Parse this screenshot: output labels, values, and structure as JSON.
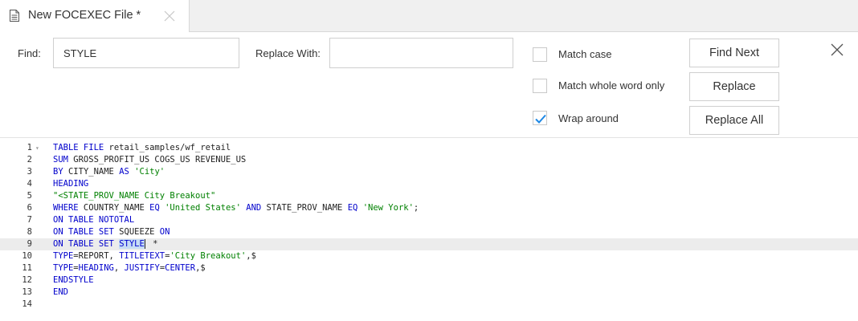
{
  "tab": {
    "title": "New FOCEXEC File *"
  },
  "find_bar": {
    "find_label": "Find:",
    "find_value": "STYLE",
    "replace_label": "Replace With:",
    "replace_value": "",
    "options": [
      {
        "label": "Match case",
        "checked": false
      },
      {
        "label": "Match whole word only",
        "checked": false
      },
      {
        "label": "Wrap around",
        "checked": true
      }
    ],
    "buttons": {
      "find_next": "Find Next",
      "replace": "Replace",
      "replace_all": "Replace All"
    }
  },
  "colors": {
    "accent": "#1e88e5",
    "keyword": "#0000cc",
    "string": "#008000",
    "selection": "#c6dcf5",
    "active_line": "#ececec"
  },
  "editor": {
    "active_line": 9,
    "lines": [
      {
        "n": "1",
        "fold": "▾",
        "parts": [
          {
            "t": "TABLE FILE",
            "c": "kw"
          },
          {
            "t": " retail_samples/wf_retail",
            "c": "tx"
          }
        ]
      },
      {
        "n": "2",
        "parts": [
          {
            "t": "SUM",
            "c": "kw"
          },
          {
            "t": " GROSS_PROFIT_US COGS_US REVENUE_US",
            "c": "tx"
          }
        ]
      },
      {
        "n": "3",
        "parts": [
          {
            "t": "BY",
            "c": "kw"
          },
          {
            "t": " CITY_NAME ",
            "c": "tx"
          },
          {
            "t": "AS",
            "c": "kw"
          },
          {
            "t": " ",
            "c": "tx"
          },
          {
            "t": "'City'",
            "c": "str"
          }
        ]
      },
      {
        "n": "4",
        "parts": [
          {
            "t": "HEADING",
            "c": "kw"
          }
        ]
      },
      {
        "n": "5",
        "parts": [
          {
            "t": "\"<STATE_PROV_NAME City Breakout\"",
            "c": "str"
          }
        ]
      },
      {
        "n": "6",
        "parts": [
          {
            "t": "WHERE",
            "c": "kw"
          },
          {
            "t": " COUNTRY_NAME ",
            "c": "tx"
          },
          {
            "t": "EQ",
            "c": "kw"
          },
          {
            "t": " ",
            "c": "tx"
          },
          {
            "t": "'United States'",
            "c": "str"
          },
          {
            "t": " ",
            "c": "tx"
          },
          {
            "t": "AND",
            "c": "kw"
          },
          {
            "t": " STATE_PROV_NAME ",
            "c": "tx"
          },
          {
            "t": "EQ",
            "c": "kw"
          },
          {
            "t": " ",
            "c": "tx"
          },
          {
            "t": "'New York'",
            "c": "str"
          },
          {
            "t": ";",
            "c": "tx"
          }
        ]
      },
      {
        "n": "7",
        "parts": [
          {
            "t": "ON TABLE NOTOTAL",
            "c": "kw"
          }
        ]
      },
      {
        "n": "8",
        "parts": [
          {
            "t": "ON TABLE SET",
            "c": "kw"
          },
          {
            "t": " SQUEEZE ",
            "c": "tx"
          },
          {
            "t": "ON",
            "c": "kw"
          }
        ]
      },
      {
        "n": "9",
        "parts": [
          {
            "t": "ON TABLE SET",
            "c": "kw"
          },
          {
            "t": " ",
            "c": "tx"
          },
          {
            "t": "STYLE",
            "c": "kw sel"
          },
          {
            "t": "",
            "c": "cursor"
          },
          {
            "t": " *",
            "c": "tx"
          }
        ]
      },
      {
        "n": "10",
        "parts": [
          {
            "t": "TYPE",
            "c": "kw"
          },
          {
            "t": "=REPORT, ",
            "c": "tx"
          },
          {
            "t": "TITLETEXT",
            "c": "kw"
          },
          {
            "t": "=",
            "c": "tx"
          },
          {
            "t": "'City Breakout'",
            "c": "str"
          },
          {
            "t": ",$",
            "c": "tx"
          }
        ]
      },
      {
        "n": "11",
        "parts": [
          {
            "t": "TYPE",
            "c": "kw"
          },
          {
            "t": "=",
            "c": "tx"
          },
          {
            "t": "HEADING",
            "c": "kw"
          },
          {
            "t": ", ",
            "c": "tx"
          },
          {
            "t": "JUSTIFY",
            "c": "kw"
          },
          {
            "t": "=",
            "c": "tx"
          },
          {
            "t": "CENTER",
            "c": "kw"
          },
          {
            "t": ",$",
            "c": "tx"
          }
        ]
      },
      {
        "n": "12",
        "parts": [
          {
            "t": "ENDSTYLE",
            "c": "kw"
          }
        ]
      },
      {
        "n": "13",
        "parts": [
          {
            "t": "END",
            "c": "kw"
          }
        ]
      },
      {
        "n": "14",
        "parts": []
      }
    ]
  }
}
